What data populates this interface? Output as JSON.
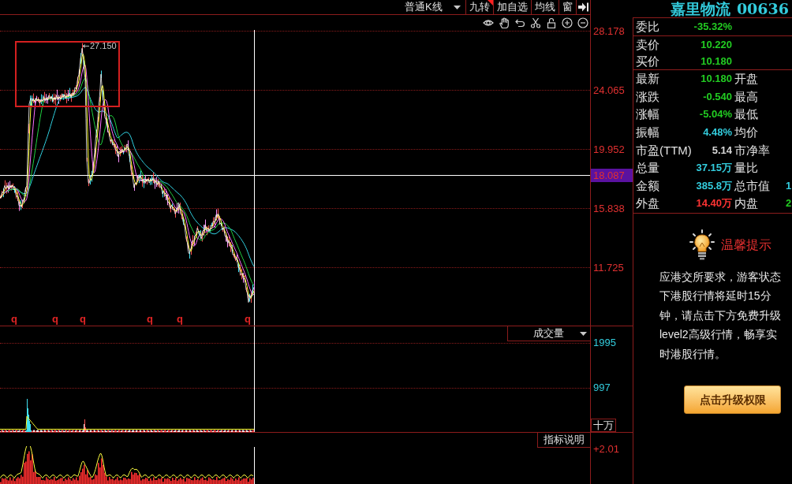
{
  "toolbar": [
    {
      "kind": "dropdown",
      "label": "普通K线"
    },
    {
      "kind": "button",
      "label": "九转",
      "corner_mark": true
    },
    {
      "kind": "button",
      "label": "加自选",
      "corner_mark": false
    },
    {
      "kind": "button",
      "label": "均线",
      "corner_mark": false
    },
    {
      "kind": "button",
      "label": "窗",
      "corner_mark": false
    },
    {
      "kind": "collapse"
    }
  ],
  "price_pane": {
    "axis_labels": [
      "28.178",
      "24.065",
      "19.952",
      "15.838",
      "11.725"
    ],
    "crosshair_label": "18.087",
    "max_label": "27.150",
    "markers": [
      "q",
      "q",
      "q",
      "q",
      "q",
      "q"
    ]
  },
  "volume_pane": {
    "selector": "成交量",
    "axis_labels": [
      "1995",
      "997"
    ],
    "unit": "十万"
  },
  "indicator_pane": {
    "button": "指标说明",
    "axis_labels": [
      "+2.01"
    ]
  },
  "stock": {
    "name": "嘉里物流",
    "code": "00636"
  },
  "quote": {
    "groups": [
      [
        {
          "cells": [
            {
              "label": "委比",
              "value": "-35.32%",
              "color": "#22cc22"
            }
          ]
        }
      ],
      [
        {
          "cells": [
            {
              "label": "卖价",
              "value": "10.220",
              "color": "#22cc22"
            }
          ]
        },
        {
          "cells": [
            {
              "label": "买价",
              "value": "10.180",
              "color": "#22cc22"
            }
          ]
        }
      ],
      [
        {
          "cells": [
            {
              "label": "最新",
              "value": "10.180",
              "color": "#22cc22"
            },
            {
              "label": "开盘"
            }
          ]
        },
        {
          "cells": [
            {
              "label": "涨跌",
              "value": "-0.540",
              "color": "#22cc22"
            },
            {
              "label": "最高"
            }
          ]
        },
        {
          "cells": [
            {
              "label": "涨幅",
              "value": "-5.04%",
              "color": "#22cc22"
            },
            {
              "label": "最低"
            }
          ]
        },
        {
          "cells": [
            {
              "label": "振幅",
              "value": "4.48%",
              "color": "#33ccdd"
            },
            {
              "label": "均价"
            }
          ]
        },
        {
          "cells": [
            {
              "label": "市盈(TTM)",
              "value": "5.14",
              "color": "#d8d8d8"
            },
            {
              "label": "市净率"
            }
          ]
        },
        {
          "cells": [
            {
              "label": "总量",
              "value": "37.15万",
              "color": "#33ccdd"
            },
            {
              "label": "量比"
            }
          ]
        },
        {
          "cells": [
            {
              "label": "金额",
              "value": "385.8万",
              "color": "#33ccdd"
            },
            {
              "label": "总市值",
              "value": "1",
              "color": "#33ccdd"
            }
          ]
        },
        {
          "cells": [
            {
              "label": "外盘",
              "value": "14.40万",
              "color": "#ff3333"
            },
            {
              "label": "内盘",
              "value": "2",
              "color": "#22cc22"
            }
          ]
        }
      ]
    ]
  },
  "tip": {
    "title": "温馨提示",
    "lines": [
      "应港交所要求，游客状态",
      "下港股行情将延时15分",
      "钟，请点击下方免费升级",
      "level2高级行情，畅享实",
      "时港股行情。"
    ],
    "button": "点击升级权限"
  }
}
